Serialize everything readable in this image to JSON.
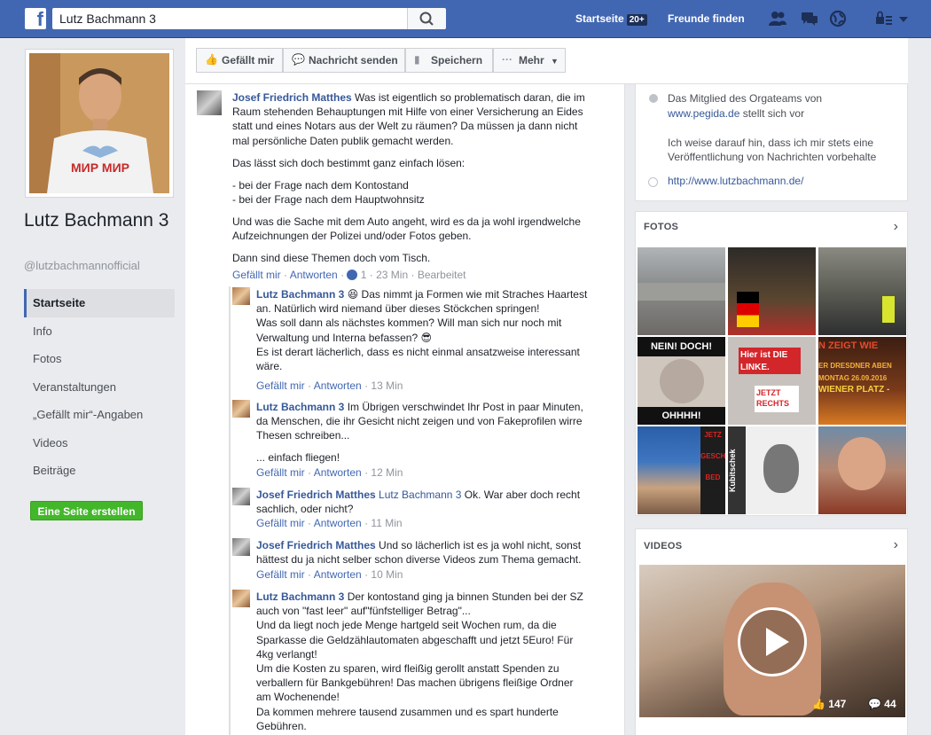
{
  "topbar": {
    "search_value": "Lutz Bachmann 3",
    "home_label": "Startseite",
    "home_badge": "20+",
    "find_friends_label": "Freunde finden"
  },
  "profile": {
    "name": "Lutz Bachmann 3",
    "handle": "@lutzbachmannofficial",
    "shirt_text": "МИР МИР"
  },
  "nav": {
    "items": [
      "Startseite",
      "Info",
      "Fotos",
      "Veranstaltungen",
      "„Gefällt mir“-Angaben",
      "Videos",
      "Beiträge"
    ],
    "create_page": "Eine Seite erstellen"
  },
  "actions": {
    "like": "Gefällt mir",
    "message": "Nachricht senden",
    "save": "Speichern",
    "more": "Mehr"
  },
  "feed": {
    "c1": {
      "author": "Josef Friedrich Matthes",
      "lines": [
        " Was ist eigentlich so problematisch daran, die im",
        "Raum stehenden Behauptungen mit Hilfe von einer Versicherung an Eides",
        "statt und eines Notars aus der Welt zu räumen? Da müssen ja dann nicht",
        "mal persönliche Daten publik gemacht werden."
      ],
      "p2": "Das lässt sich doch bestimmt ganz einfach lösen:",
      "p3a": "- bei der Frage nach dem Kontostand",
      "p3b": "- bei der Frage nach dem Hauptwohnsitz",
      "p4a": "Und was die Sache mit dem Auto angeht, wird es da ja wohl irgendwelche",
      "p4b": "Aufzeichnungen der Polizei und/oder Fotos geben.",
      "p5": "Dann sind diese Themen doch vom Tisch.",
      "meta_like": "Gefällt mir",
      "meta_reply": "Antworten",
      "meta_count": "1",
      "meta_time": "23 Min",
      "meta_edited": "Bearbeitet"
    },
    "r1": {
      "author": "Lutz Bachmann 3",
      "lines": [
        " Das nimmt ja Formen wie mit Straches Haartest",
        "an. Natürlich wird niemand über dieses Stöckchen springen!",
        "Was soll dann als nächstes kommen? Will man sich nur noch mit",
        "Verwaltung und Interna befassen? 😎",
        "Es ist derart lächerlich, dass es nicht einmal ansatzweise interessant",
        "wäre."
      ],
      "meta_like": "Gefällt mir",
      "meta_reply": "Antworten",
      "meta_time": "13 Min"
    },
    "r2": {
      "author": "Lutz Bachmann 3",
      "lines": [
        " Im Übrigen verschwindet Ihr Post in paar Minuten,",
        "da Menschen, die ihr Gesicht nicht zeigen und von Fakeprofilen wirre",
        "Thesen schreiben..."
      ],
      "p2": "... einfach fliegen!",
      "meta_like": "Gefällt mir",
      "meta_reply": "Antworten",
      "meta_time": "12 Min"
    },
    "r3": {
      "author": "Josef Friedrich Matthes",
      "mention": " Lutz Bachmann 3",
      "lines": [
        " Ok. War aber doch recht",
        "sachlich, oder nicht?"
      ],
      "meta_like": "Gefällt mir",
      "meta_reply": "Antworten",
      "meta_time": "11 Min"
    },
    "r4": {
      "author": "Josef Friedrich Matthes",
      "lines": [
        " Und so lächerlich ist es ja wohl nicht, sonst",
        "hättest du ja nicht selber schon diverse Videos zum Thema gemacht."
      ],
      "meta_like": "Gefällt mir",
      "meta_reply": "Antworten",
      "meta_time": "10 Min"
    },
    "r5": {
      "author": "Lutz Bachmann 3",
      "lines": [
        " Der kontostand ging ja binnen Stunden bei der SZ",
        "auch von \"fast leer\" auf\"fünfstelliger Betrag\"...",
        "Und da liegt noch jede Menge hartgeld seit Wochen rum, da die",
        "Sparkasse die Geldzählautomaten abgeschafft und jetzt 5Euro! Für",
        "4kg verlangt!",
        "Um die Kosten zu sparen, wird fleißig gerollt anstatt Spenden zu",
        "verballern für Bankgebühren! Das machen übrigens fleißige Ordner",
        "am Wochenende!",
        "Da kommen mehrere tausend zusammen und es spart hunderte",
        "Gebühren."
      ]
    }
  },
  "about": {
    "line1": "Das Mitglied des Orgateams von",
    "link1": "www.pegida.de",
    "line1b": " stellt sich vor",
    "line2a": "Ich weise darauf hin, dass ich mir stets eine",
    "line2b": "Veröffentlichung von Nachrichten vorbehalte",
    "website": "http://www.lutzbachmann.de/"
  },
  "photos": {
    "title": "FOTOS",
    "captions": [
      "NEIN! DOCH!",
      "OHHHH!",
      "Hier ist DIE LINKE.",
      "JETZT RECHTS",
      "N ZEIGT WIE",
      "ER DRESDNER ABEN",
      "MONTAG 26.09.2016",
      "WIENER PLATZ -",
      "Kubitschek",
      "JETZ",
      "GESCH",
      "BED"
    ]
  },
  "videos": {
    "title": "VIDEOS",
    "likes": "147",
    "comments": "44"
  },
  "colors": {
    "brand": "#4267b2",
    "link": "#365899",
    "green": "#42b72a"
  }
}
